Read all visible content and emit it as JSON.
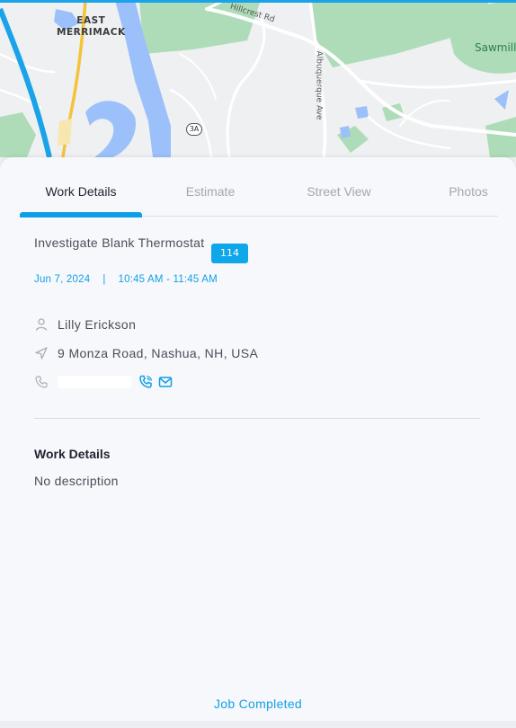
{
  "map": {
    "labels": {
      "town": "EAST\nMERRIMACK",
      "park": "Sawmill",
      "street_hillcrest": "Hillcrest Rd",
      "street_albuquerque": "Albuquerque Ave",
      "route_shield": "3A"
    },
    "colors": {
      "water": "#9cc0f9",
      "park": "#aedcb8",
      "road": "#ffffff",
      "highway": "#f5c33b",
      "route": "#1aa3e8"
    }
  },
  "tabs": [
    {
      "label": "Work Details",
      "active": true
    },
    {
      "label": "Estimate",
      "active": false
    },
    {
      "label": "Street View",
      "active": false
    },
    {
      "label": "Photos",
      "active": false
    }
  ],
  "job": {
    "title": "Investigate Blank Thermostat",
    "badge": "114",
    "date": "Jun 7, 2024",
    "separator": "|",
    "time": "10:45 AM - 11:45 AM"
  },
  "customer": {
    "name": "Lilly Erickson",
    "address": "9 Monza Road, Nashua, NH, USA",
    "icons": {
      "person": "person-icon",
      "location": "location-arrow-icon",
      "phone": "phone-icon",
      "call": "call-icon",
      "email": "mail-icon"
    }
  },
  "work_details": {
    "heading": "Work Details",
    "description": "No description"
  },
  "footer": {
    "action_label": "Job Completed"
  },
  "colors": {
    "accent": "#0f9fe6",
    "text": "#4a4e58",
    "background": "#f7f8fc"
  }
}
